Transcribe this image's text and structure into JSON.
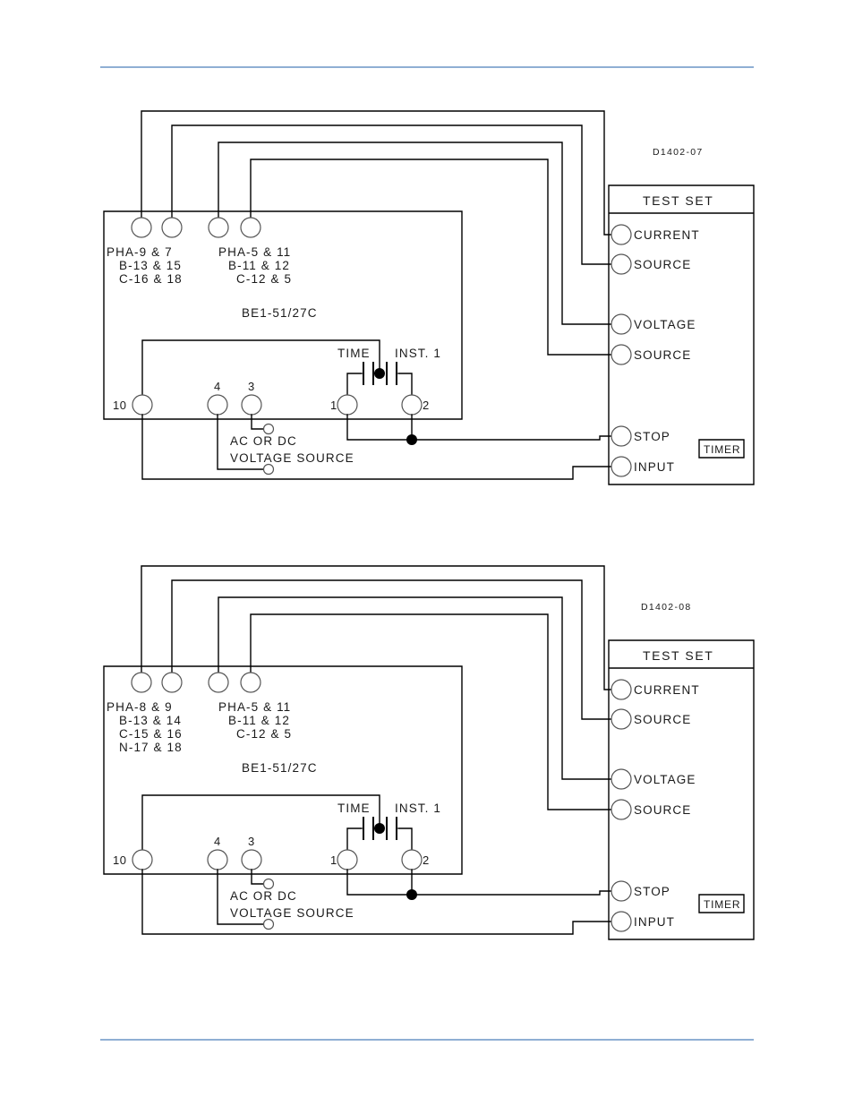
{
  "page": {
    "rule_color": "#8fafd4"
  },
  "diagrams": [
    {
      "drawing_number": "D1402-07",
      "relay": {
        "model": "BE1-51/27C",
        "terminal_groups": [
          {
            "lines": [
              "PHA-9  &  7",
              "B-13  &  15",
              "C-16  &  18"
            ]
          },
          {
            "lines": [
              "PHA-5  &  11",
              "B-11  &  12",
              "C-12  &  5"
            ]
          }
        ],
        "terminals": {
          "left_aux": "10",
          "source_a": "4",
          "source_b": "3",
          "contact_left": "1",
          "contact_right": "2"
        },
        "contacts": {
          "time": "TIME",
          "inst": "INST. 1"
        },
        "source_note_line1": "AC OR DC",
        "source_note_line2": "VOLTAGE SOURCE"
      },
      "test_set": {
        "title": "TEST SET",
        "terminals": [
          "CURRENT",
          "SOURCE",
          "VOLTAGE",
          "SOURCE",
          "STOP",
          "INPUT"
        ],
        "timer_label": "TIMER"
      }
    },
    {
      "drawing_number": "D1402-08",
      "relay": {
        "model": "BE1-51/27C",
        "terminal_groups": [
          {
            "lines": [
              "PHA-8  &  9",
              "B-13  &  14",
              "C-15  &  16",
              "N-17  &  18"
            ]
          },
          {
            "lines": [
              "PHA-5  &  11",
              "B-11  &  12",
              "C-12  &  5"
            ]
          }
        ],
        "terminals": {
          "left_aux": "10",
          "source_a": "4",
          "source_b": "3",
          "contact_left": "1",
          "contact_right": "2"
        },
        "contacts": {
          "time": "TIME",
          "inst": "INST. 1"
        },
        "source_note_line1": "AC OR DC",
        "source_note_line2": "VOLTAGE SOURCE"
      },
      "test_set": {
        "title": "TEST SET",
        "terminals": [
          "CURRENT",
          "SOURCE",
          "VOLTAGE",
          "SOURCE",
          "STOP",
          "INPUT"
        ],
        "timer_label": "TIMER"
      }
    }
  ]
}
